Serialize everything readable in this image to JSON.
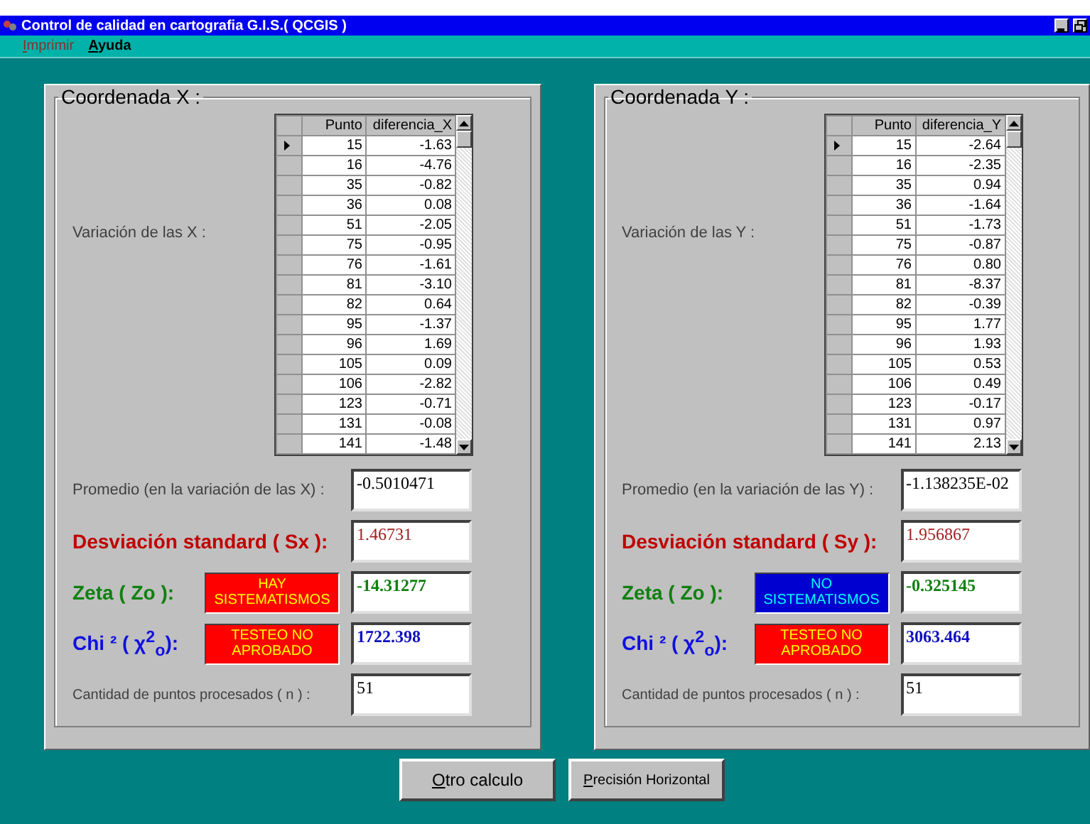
{
  "window": {
    "title": "Control de calidad en cartografia G.I.S.( QCGIS )"
  },
  "menu": [
    {
      "label": "Imprimir",
      "disabled": true
    },
    {
      "label": "Ayuda",
      "disabled": false
    }
  ],
  "panels": [
    {
      "title": "Coordenada X :",
      "variation_label": "Variación de las X :",
      "grid": {
        "columns": [
          "Punto",
          "diferencia_X"
        ],
        "rows": [
          {
            "cells": [
              "15",
              "-1.63"
            ],
            "selected": true
          },
          {
            "cells": [
              "16",
              "-4.76"
            ],
            "selected": false
          },
          {
            "cells": [
              "35",
              "-0.82"
            ],
            "selected": false
          },
          {
            "cells": [
              "36",
              "0.08"
            ],
            "selected": false
          },
          {
            "cells": [
              "51",
              "-2.05"
            ],
            "selected": false
          },
          {
            "cells": [
              "75",
              "-0.95"
            ],
            "selected": false
          },
          {
            "cells": [
              "76",
              "-1.61"
            ],
            "selected": false
          },
          {
            "cells": [
              "81",
              "-3.10"
            ],
            "selected": false
          },
          {
            "cells": [
              "82",
              "0.64"
            ],
            "selected": false
          },
          {
            "cells": [
              "95",
              "-1.37"
            ],
            "selected": false
          },
          {
            "cells": [
              "96",
              "1.69"
            ],
            "selected": false
          },
          {
            "cells": [
              "105",
              "0.09"
            ],
            "selected": false
          },
          {
            "cells": [
              "106",
              "-2.82"
            ],
            "selected": false
          },
          {
            "cells": [
              "123",
              "-0.71"
            ],
            "selected": false
          },
          {
            "cells": [
              "131",
              "-0.08"
            ],
            "selected": false
          },
          {
            "cells": [
              "141",
              "-1.48"
            ],
            "selected": false
          }
        ]
      },
      "stats": [
        {
          "kind": "mean",
          "label": "Promedio (en la variación de las X) :",
          "value": "-0.5010471"
        },
        {
          "kind": "std",
          "label": "Desviación standard ( Sx ):",
          "value": "1.46731"
        },
        {
          "kind": "zeta",
          "label": "Zeta ( Zo ):",
          "status": {
            "text": "HAY SISTEMATISMOS",
            "kind": "fail"
          },
          "value": "-14.31277"
        },
        {
          "kind": "chi",
          "label": "Chi ² ( χ$^{2}$$_{o}$):",
          "status": {
            "text": "TESTEO NO APROBADO",
            "kind": "fail"
          },
          "value": "1722.398"
        },
        {
          "kind": "count",
          "label": "Cantidad de puntos procesados ( n ) :",
          "value": "51"
        }
      ]
    },
    {
      "title": "Coordenada Y :",
      "variation_label": "Variación de las Y :",
      "grid": {
        "columns": [
          "Punto",
          "diferencia_Y"
        ],
        "rows": [
          {
            "cells": [
              "15",
              "-2.64"
            ],
            "selected": true
          },
          {
            "cells": [
              "16",
              "-2.35"
            ],
            "selected": false
          },
          {
            "cells": [
              "35",
              "0.94"
            ],
            "selected": false
          },
          {
            "cells": [
              "36",
              "-1.64"
            ],
            "selected": false
          },
          {
            "cells": [
              "51",
              "-1.73"
            ],
            "selected": false
          },
          {
            "cells": [
              "75",
              "-0.87"
            ],
            "selected": false
          },
          {
            "cells": [
              "76",
              "0.80"
            ],
            "selected": false
          },
          {
            "cells": [
              "81",
              "-8.37"
            ],
            "selected": false
          },
          {
            "cells": [
              "82",
              "-0.39"
            ],
            "selected": false
          },
          {
            "cells": [
              "95",
              "1.77"
            ],
            "selected": false
          },
          {
            "cells": [
              "96",
              "1.93"
            ],
            "selected": false
          },
          {
            "cells": [
              "105",
              "0.53"
            ],
            "selected": false
          },
          {
            "cells": [
              "106",
              "0.49"
            ],
            "selected": false
          },
          {
            "cells": [
              "123",
              "-0.17"
            ],
            "selected": false
          },
          {
            "cells": [
              "131",
              "0.97"
            ],
            "selected": false
          },
          {
            "cells": [
              "141",
              "2.13"
            ],
            "selected": false
          }
        ]
      },
      "stats": [
        {
          "kind": "mean",
          "label": "Promedio (en la variación de las Y) :",
          "value": "-1.138235E-02"
        },
        {
          "kind": "std",
          "label": "Desviación standard ( Sy ):",
          "value": "1.956867"
        },
        {
          "kind": "zeta",
          "label": "Zeta ( Zo ):",
          "status": {
            "text": "NO SISTEMATISMOS",
            "kind": "pass"
          },
          "value": "-0.325145"
        },
        {
          "kind": "chi",
          "label": "Chi ² ( χ$^{2}$$_{o}$):",
          "status": {
            "text": "TESTEO NO APROBADO",
            "kind": "fail"
          },
          "value": "3063.464"
        },
        {
          "kind": "count",
          "label": "Cantidad de puntos procesados ( n ) :",
          "value": "51"
        }
      ]
    }
  ],
  "buttons": [
    "Otro calculo",
    "Precisión Horizontal"
  ]
}
